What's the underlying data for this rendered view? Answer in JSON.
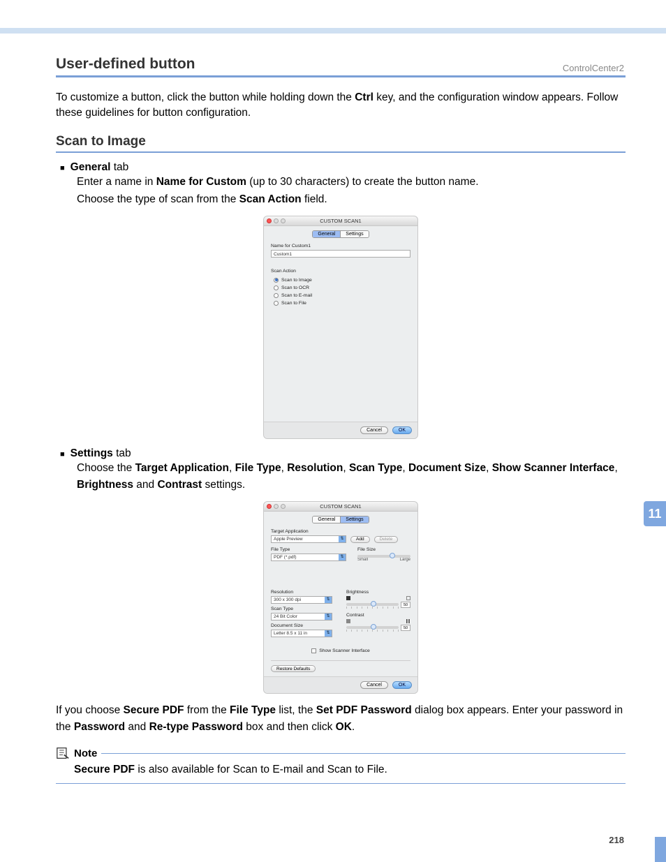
{
  "header": "ControlCenter2",
  "section1_title": "User-defined button",
  "section1_body_pre": "To customize a button, click the button while holding down the ",
  "section1_body_bold": "Ctrl",
  "section1_body_post": " key, and the configuration window appears. Follow these guidelines for button configuration.",
  "section2_title": "Scan to Image",
  "bullet1_bold": "General",
  "bullet1_rest": " tab",
  "bullet1_body_l1_pre": "Enter a name in ",
  "bullet1_body_l1_bold": "Name for Custom",
  "bullet1_body_l1_post": " (up to 30 characters) to create the button name.",
  "bullet1_body_l2_pre": "Choose the type of scan from the ",
  "bullet1_body_l2_bold": "Scan Action",
  "bullet1_body_l2_post": " field.",
  "dialog_title": "CUSTOM SCAN1",
  "tab_general": "General",
  "tab_settings": "Settings",
  "label_name_for_custom": "Name for Custom1",
  "value_custom": "Custom1",
  "label_scan_action": "Scan Action",
  "radio_image": "Scan to Image",
  "radio_ocr": "Scan to OCR",
  "radio_email": "Scan to E-mail",
  "radio_file": "Scan to File",
  "btn_cancel": "Cancel",
  "btn_ok": "OK",
  "bullet2_bold": "Settings",
  "bullet2_rest": " tab",
  "b2_pre": "Choose the ",
  "b2_b1": "Target Application",
  "b2_s1": ", ",
  "b2_b2": "File Type",
  "b2_s2": ", ",
  "b2_b3": "Resolution",
  "b2_s3": ", ",
  "b2_b4": "Scan Type",
  "b2_s4": ", ",
  "b2_b5": "Document Size",
  "b2_s5": ", ",
  "b2_b6": "Show Scanner Interface",
  "b2_s6": ", ",
  "b2_b7": "Brightness",
  "b2_s7": " and ",
  "b2_b8": "Contrast",
  "b2_s8": " settings.",
  "lbl_target_app": "Target Application",
  "val_target_app": "Apple Preview",
  "btn_add": "Add",
  "btn_delete": "Delete",
  "lbl_file_type": "File Type",
  "val_file_type": "PDF (*.pdf)",
  "lbl_file_size": "File Size",
  "txt_small": "Small",
  "txt_large": "Large",
  "lbl_resolution": "Resolution",
  "val_resolution": "300 x 300 dpi",
  "lbl_scan_type": "Scan Type",
  "val_scan_type": "24 Bit Color",
  "lbl_doc_size": "Document Size",
  "val_doc_size": "Letter  8.5 x 11 in",
  "lbl_brightness": "Brightness",
  "lbl_contrast": "Contrast",
  "val_50": "50",
  "chk_show_scanner": "Show Scanner Interface",
  "btn_restore": "Restore Defaults",
  "after_pre": "If you choose ",
  "after_b1": "Secure PDF",
  "after_s1": " from the ",
  "after_b2": "File Type",
  "after_s2": " list, the ",
  "after_b3": "Set PDF Password",
  "after_s3": " dialog box appears. Enter your password in the ",
  "after_b4": "Password",
  "after_s4": " and ",
  "after_b5": "Re-type Password",
  "after_s5": " box and then click ",
  "after_b6": "OK",
  "after_s6": ".",
  "note_label": "Note",
  "note_b1": "Secure PDF",
  "note_rest": " is also available for Scan to E-mail and Scan to File.",
  "side_tab": "11",
  "page_num": "218"
}
